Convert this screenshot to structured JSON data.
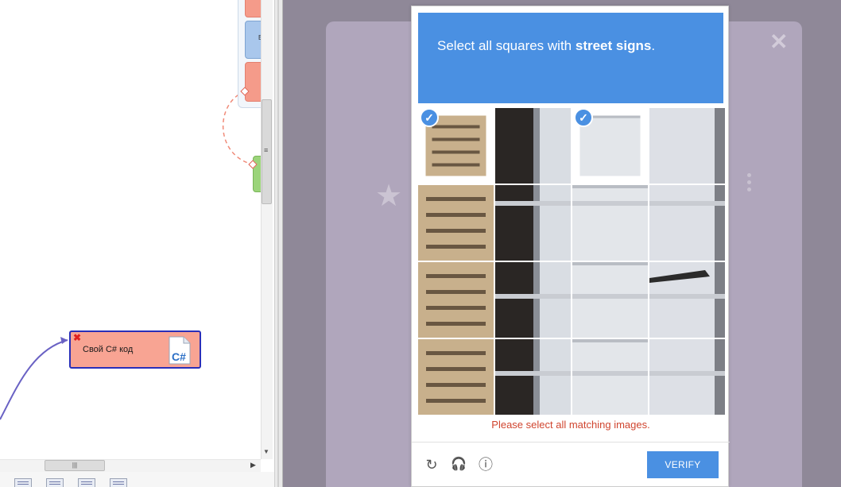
{
  "designer": {
    "node": {
      "label": "Свой C# код",
      "icon_text": "C#",
      "close_glyph": "✖"
    },
    "blue_block_text": "E",
    "scrollbar_grip": "≡",
    "h_scroll_grip": "|||",
    "h_scroll_right": "▶",
    "v_scroll_down": "▼"
  },
  "overlay": {
    "close_glyph": "✕",
    "star_glyph": "★"
  },
  "captcha": {
    "instruction_prefix": "Select all squares with",
    "instruction_target": "street signs",
    "instruction_suffix": ".",
    "selected_tiles": [
      0,
      2
    ],
    "error": "Please select all matching images.",
    "reload_icon": "↻",
    "audio_icon": "🎧",
    "info_icon": "ⓘ",
    "verify_label": "VERIFY",
    "check_glyph": "✓",
    "colors": {
      "accent": "#4a90e2",
      "error": "#d0452f"
    }
  }
}
